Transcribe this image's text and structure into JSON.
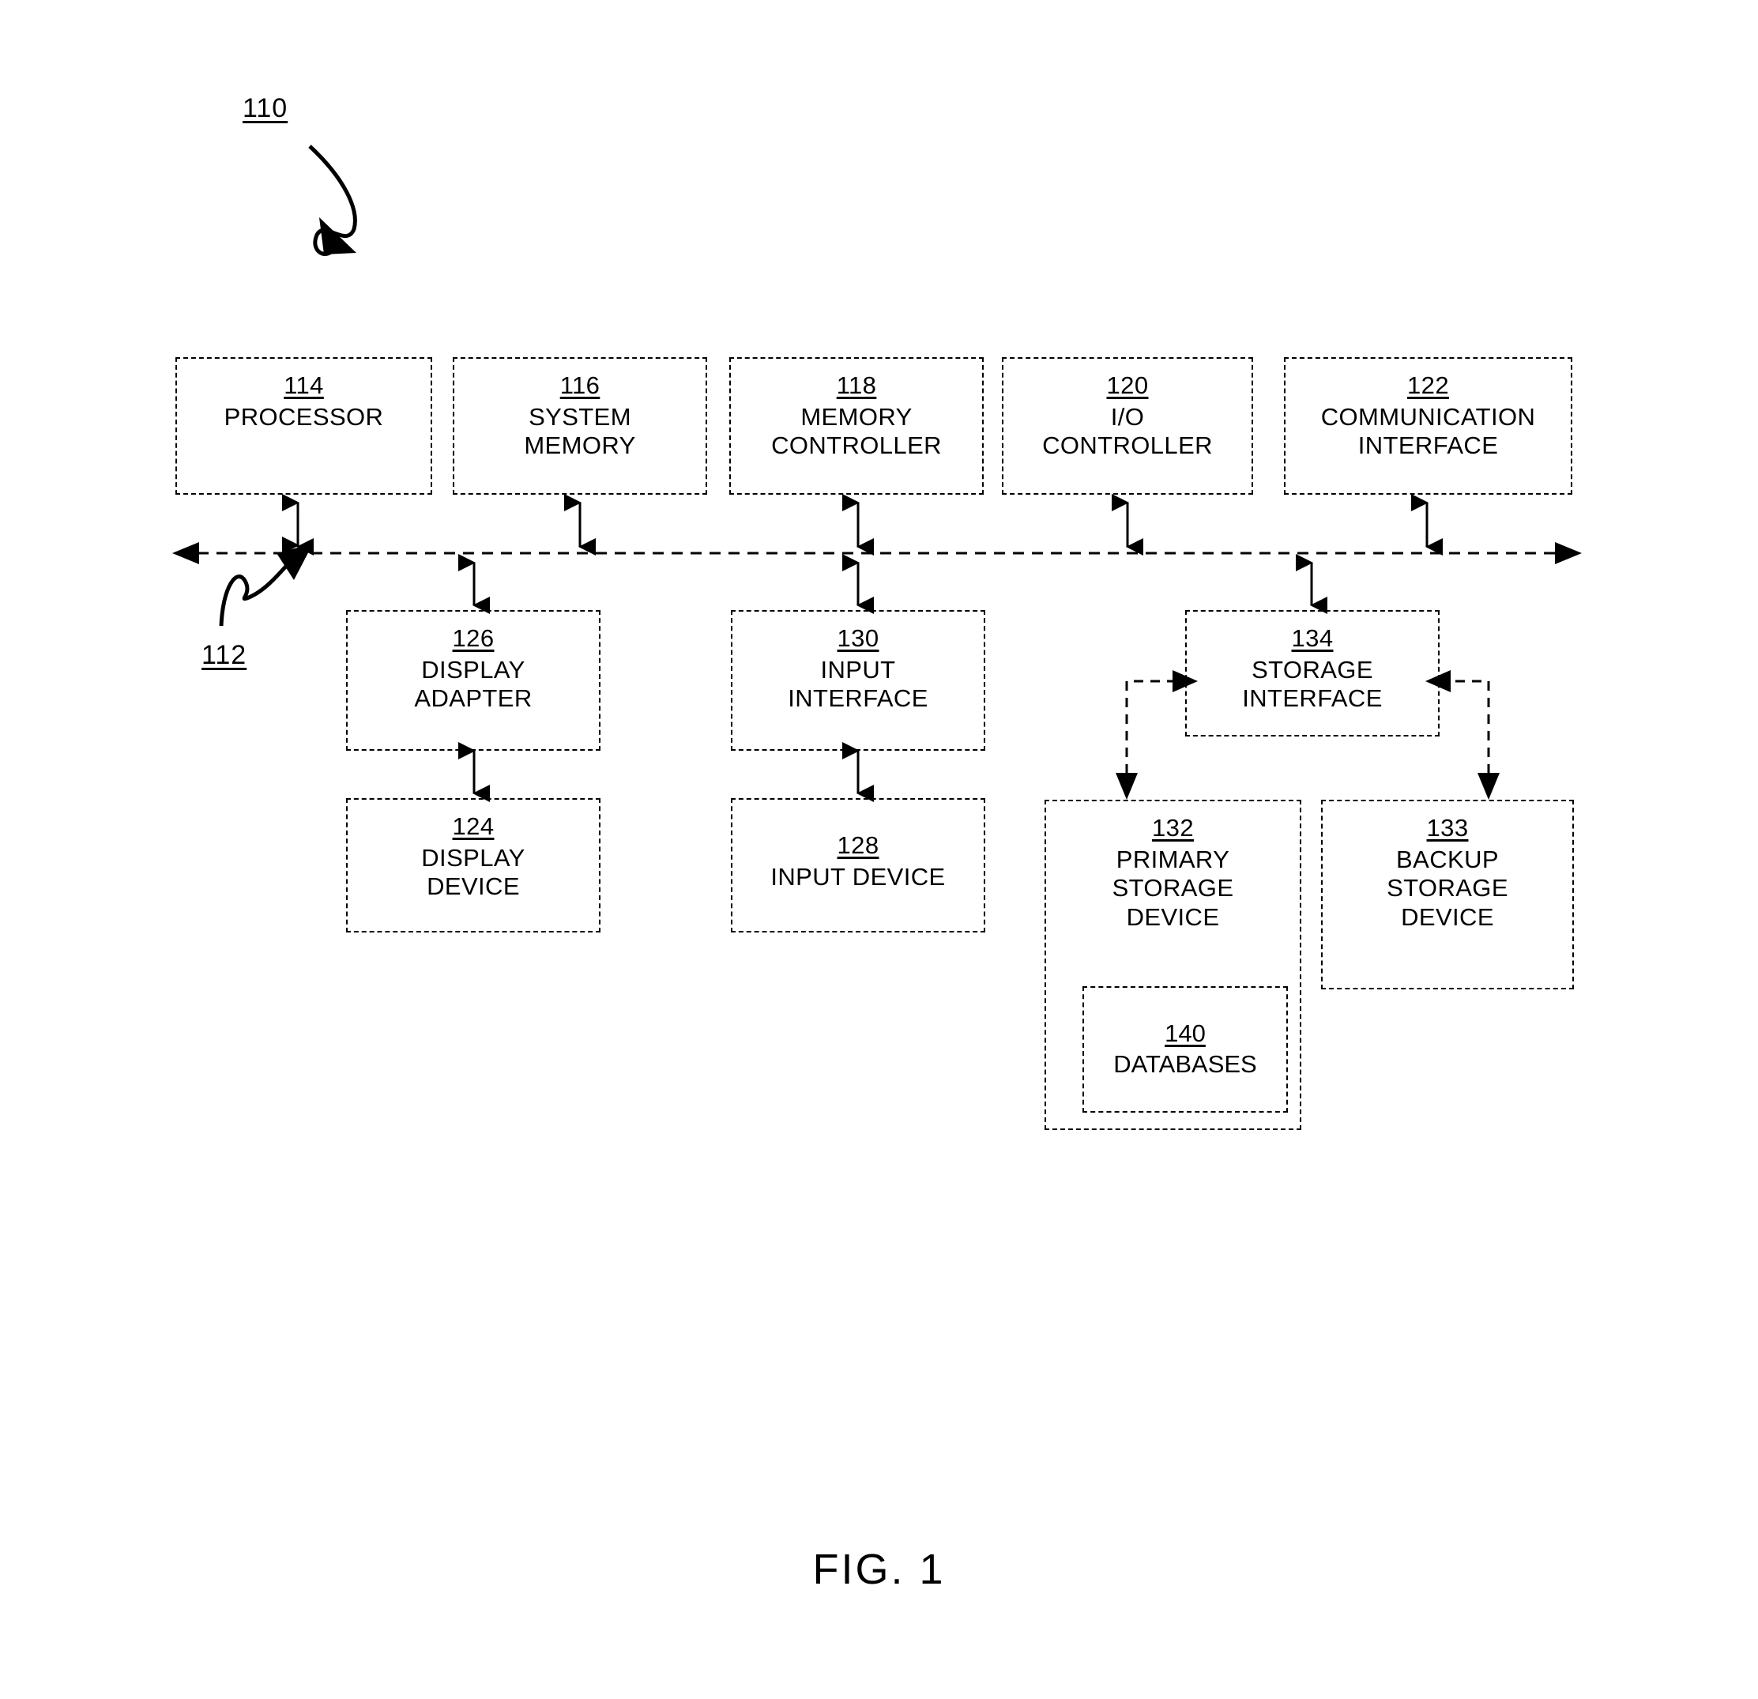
{
  "figure": {
    "caption": "FIG. 1",
    "system_ref": "110",
    "bus_ref": "112"
  },
  "nodes": {
    "processor": {
      "ref": "114",
      "label": "PROCESSOR"
    },
    "system_memory": {
      "ref": "116",
      "label": "SYSTEM\nMEMORY"
    },
    "memory_controller": {
      "ref": "118",
      "label": "MEMORY\nCONTROLLER"
    },
    "io_controller": {
      "ref": "120",
      "label": "I/O\nCONTROLLER"
    },
    "communication_interface": {
      "ref": "122",
      "label": "COMMUNICATION\nINTERFACE"
    },
    "display_adapter": {
      "ref": "126",
      "label": "DISPLAY\nADAPTER"
    },
    "display_device": {
      "ref": "124",
      "label": "DISPLAY\nDEVICE"
    },
    "input_interface": {
      "ref": "130",
      "label": "INPUT\nINTERFACE"
    },
    "input_device": {
      "ref": "128",
      "label": "INPUT DEVICE"
    },
    "storage_interface": {
      "ref": "134",
      "label": "STORAGE\nINTERFACE"
    },
    "primary_storage_device": {
      "ref": "132",
      "label": "PRIMARY\nSTORAGE\nDEVICE"
    },
    "backup_storage_device": {
      "ref": "133",
      "label": "BACKUP\nSTORAGE\nDEVICE"
    },
    "databases": {
      "ref": "140",
      "label": "DATABASES"
    }
  },
  "colors": {
    "line": "#000000",
    "background": "#ffffff"
  }
}
